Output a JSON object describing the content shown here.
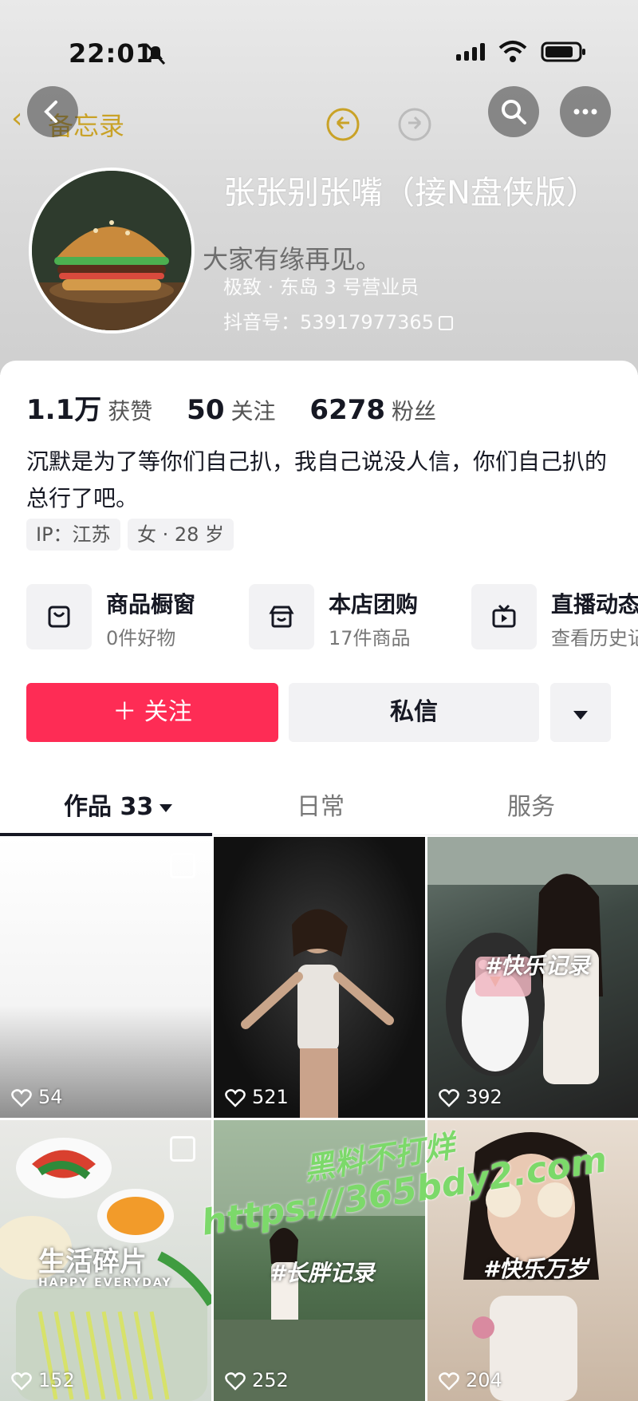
{
  "status_bar": {
    "time": "22:01"
  },
  "nav": {
    "ghost_back_label": "备忘录"
  },
  "profile": {
    "name": "张张别张嘴（接N盘侠版）",
    "overlay_text": "大家有缘再见。",
    "meta_location": "极致 · 东岛 3 号营业员",
    "douyin_id": "抖音号：53917977365"
  },
  "stats": [
    {
      "value": "1.1万",
      "label": "获赞"
    },
    {
      "value": "50",
      "label": "关注"
    },
    {
      "value": "6278",
      "label": "粉丝"
    }
  ],
  "bio": "沉默是为了等你们自己扒，我自己说没人信，你们自己扒的总行了吧。",
  "tags": [
    "IP：江苏",
    "女 · 28 岁"
  ],
  "features": [
    {
      "title": "商品橱窗",
      "sub": "0件好物",
      "icon": "bag-icon"
    },
    {
      "title": "本店团购",
      "sub": "17件商品",
      "icon": "store-icon"
    },
    {
      "title": "直播动态",
      "sub": "查看历史记录",
      "icon": "tv-icon"
    }
  ],
  "actions": {
    "follow": "＋ 关注",
    "message": "私信"
  },
  "tabs": [
    {
      "label": "作品 33"
    },
    {
      "label": "日常"
    },
    {
      "label": "服务"
    }
  ],
  "videos": [
    {
      "likes": "54",
      "tagline": ""
    },
    {
      "likes": "521",
      "tagline": ""
    },
    {
      "likes": "392",
      "tagline": "#快乐记录"
    },
    {
      "likes": "152",
      "tagline": "生活碎片"
    },
    {
      "likes": "252",
      "tagline": "#长胖记录"
    },
    {
      "likes": "204",
      "tagline": "#快乐万岁"
    }
  ],
  "video_subcaption": "HAPPY EVERYDAY",
  "watermark": {
    "line1": "黑料不打烊",
    "line2": "https://365bdy2.com"
  },
  "colors": {
    "accent": "#fe2c55",
    "ghost_gold": "#c9a227"
  }
}
